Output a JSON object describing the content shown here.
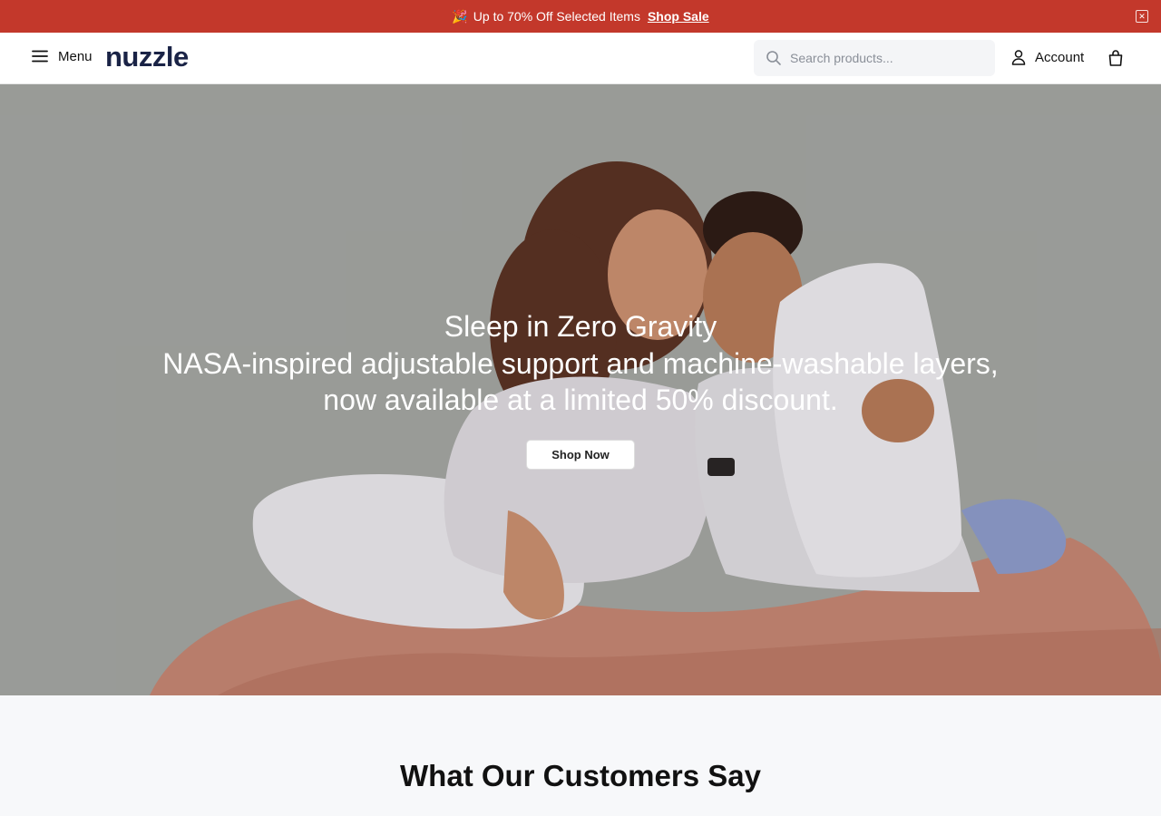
{
  "promo": {
    "emoji": "🎉",
    "text": "Up to 70% Off Selected Items",
    "link_label": "Shop Sale",
    "close_icon": "close-icon",
    "color": "#c3382b"
  },
  "header": {
    "menu_label": "Menu",
    "logo_text": "nuzzle",
    "logo_color": "#1a2346",
    "search_placeholder": "Search products...",
    "account_label": "Account",
    "icons": [
      "hamburger-icon",
      "search-icon",
      "user-icon",
      "shopping-bag-icon"
    ]
  },
  "hero": {
    "title": "Sleep in Zero Gravity",
    "subtitle_line1": "NASA-inspired adjustable support and machine-washable layers,",
    "subtitle_line2": "now available at a limited 50% discount.",
    "cta_label": "Shop Now"
  },
  "testimonials": {
    "heading": "What Our Customers Say"
  }
}
